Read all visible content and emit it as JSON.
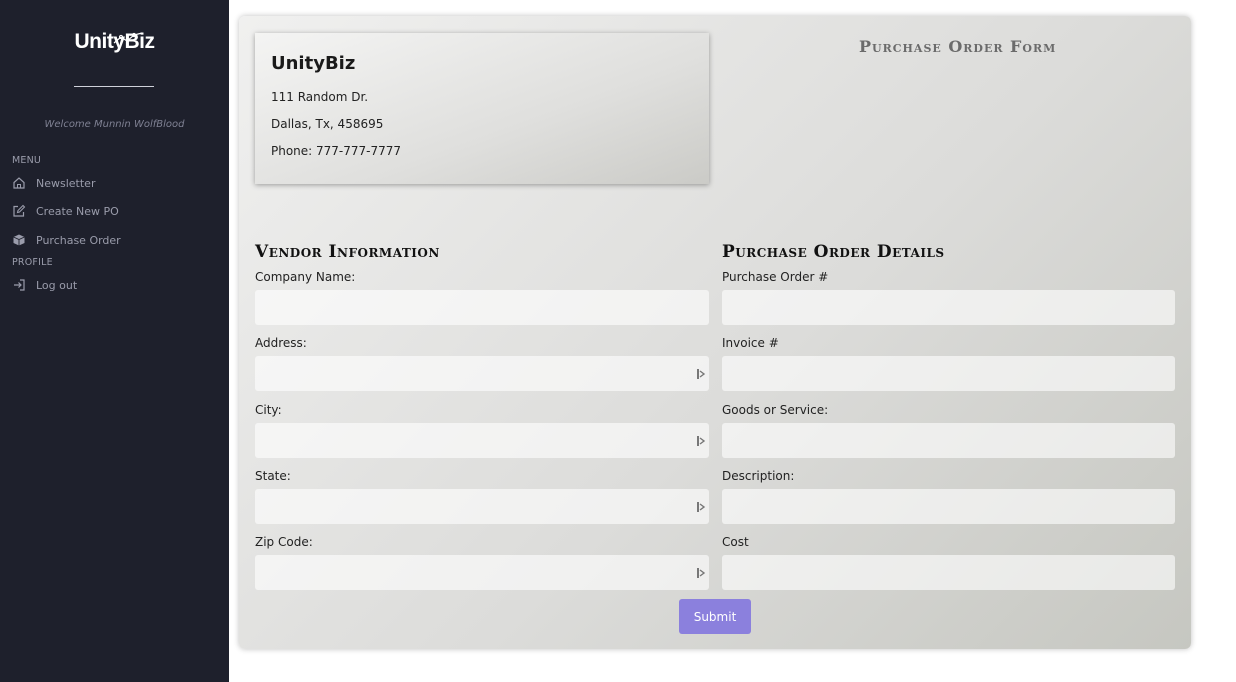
{
  "sidebar": {
    "logo": "UnityBiz",
    "welcome": "Welcome Munnin WolfBlood",
    "menu_label": "MENU",
    "menu_items": [
      {
        "label": "Newsletter",
        "icon": "home-icon"
      },
      {
        "label": "Create New PO",
        "icon": "edit-icon"
      },
      {
        "label": "Purchase Order",
        "icon": "box-icon"
      }
    ],
    "profile_label": "PROFILE",
    "profile_items": [
      {
        "label": "Log out",
        "icon": "logout-icon"
      }
    ]
  },
  "company": {
    "name": "UnityBiz",
    "address": "111 Random Dr.",
    "city_line": "Dallas, Tx, 458695",
    "phone": "Phone: 777-777-7777"
  },
  "form": {
    "title": "Purchase Order Form",
    "vendor": {
      "heading": "Vendor Information",
      "fields": [
        {
          "label": "Company Name:",
          "value": ""
        },
        {
          "label": "Address:",
          "value": ""
        },
        {
          "label": "City:",
          "value": ""
        },
        {
          "label": "State:",
          "value": ""
        },
        {
          "label": "Zip Code:",
          "value": ""
        }
      ]
    },
    "details": {
      "heading": "Purchase Order Details",
      "fields": [
        {
          "label": "Purchase Order #",
          "value": ""
        },
        {
          "label": "Invoice #",
          "value": ""
        },
        {
          "label": "Goods or Service:",
          "value": ""
        },
        {
          "label": "Description:",
          "value": ""
        },
        {
          "label": "Cost",
          "value": ""
        }
      ]
    },
    "submit_label": "Submit"
  },
  "colors": {
    "sidebar_bg": "#1e202c",
    "accent": "#8b80dd"
  }
}
